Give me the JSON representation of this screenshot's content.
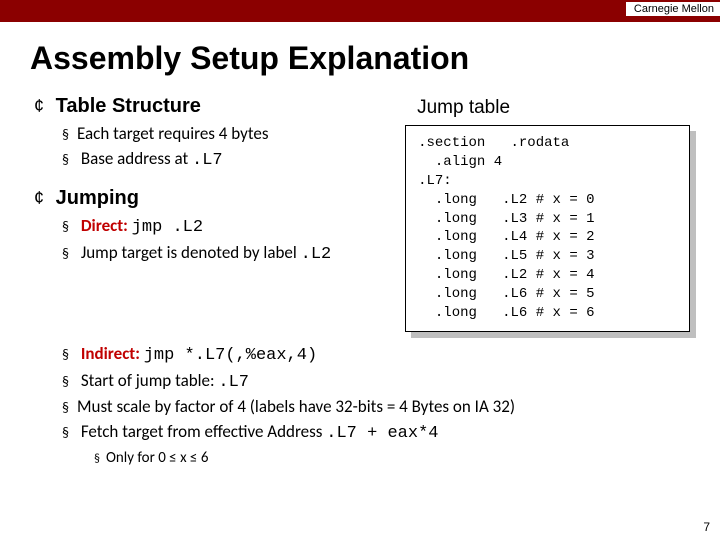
{
  "header": {
    "org": "Carnegie Mellon"
  },
  "title": "Assembly Setup Explanation",
  "sections": {
    "table_structure": {
      "title": "Table Structure",
      "b1_pre": "Each target requires 4 bytes",
      "b2_pre": "Base address at ",
      "b2_code": ".L7"
    },
    "jumping": {
      "title": "Jumping",
      "direct_label": "Direct: ",
      "direct_code": "jmp  .L2",
      "denote_pre": "Jump target is denoted by label ",
      "denote_code": ".L2",
      "indirect_label": "Indirect: ",
      "indirect_code": "jmp  *.L7(,%eax,4)",
      "start_pre": "Start of jump table: ",
      "start_code": ".L7",
      "scale": "Must scale by factor of 4 (labels have 32-bits = 4 Bytes on IA 32)",
      "fetch_pre": "Fetch target from effective Address ",
      "fetch_code": ".L7 + eax*4",
      "only": "Only for  0 ≤ x ≤ 6"
    }
  },
  "jump_table": {
    "title": "Jump table",
    "code": ".section   .rodata\n  .align 4\n.L7:\n  .long   .L2 # x = 0\n  .long   .L3 # x = 1\n  .long   .L4 # x = 2\n  .long   .L5 # x = 3\n  .long   .L2 # x = 4\n  .long   .L6 # x = 5\n  .long   .L6 # x = 6"
  },
  "page_number": "7"
}
